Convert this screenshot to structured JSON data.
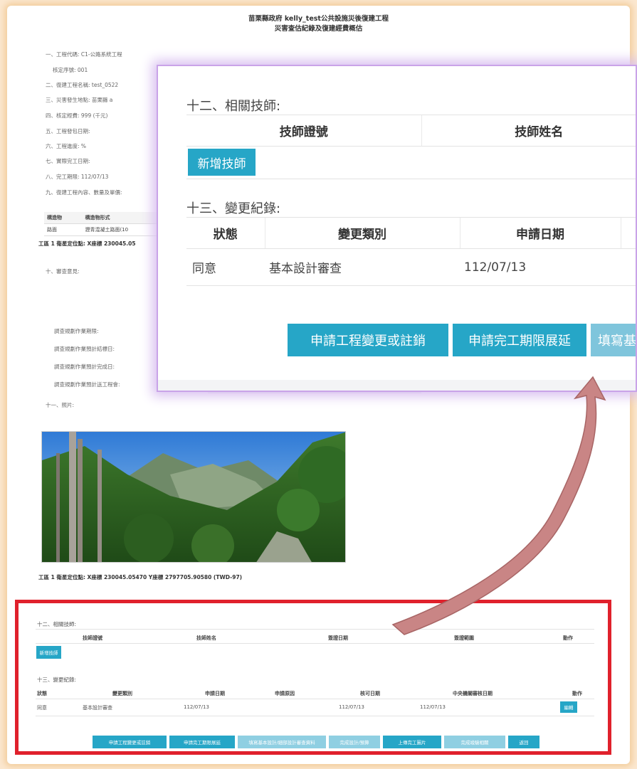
{
  "doc": {
    "title1": "苗栗縣政府 kelly_test公共設施災後復建工程",
    "title2": "災害查估紀錄及復建經費概估"
  },
  "items": [
    "一、工程代碼: C1-公路系統工程",
    "核定序號: 001",
    "二、復建工程名稱: test_0522",
    "三、災害發生地點: 苗栗縣 a",
    "四、核定經費: 999 (千元)",
    "五、工程發包日期:",
    "六、工程進度: %",
    "七、實際完工日期:",
    "八、完工期限: 112/07/13",
    "九、復建工程內容、數量及單價:"
  ],
  "mini_table": {
    "headers": [
      "構造物",
      "構造物形式"
    ],
    "row": [
      "路面",
      "瀝青混凝土路面(10"
    ]
  },
  "coord_partial": "工區 1 衛星定位點: X座標 230045.05",
  "review_label": "十、審查意見:",
  "schedule": [
    "調查規劃作業期限:",
    "調查規劃作業預計結標日:",
    "調查規劃作業預計完成日:",
    "調查規劃作業預計送工程會:"
  ],
  "photo_label": "十一、照片:",
  "photo_caption": "工區 1 衛星定位點: X座標 230045.05470  Y座標 2797705.90580 (TWD-97)",
  "zoom": {
    "sec12": "十二、相關技師:",
    "th_cert": "技師證號",
    "th_name": "技師姓名",
    "add_btn": "新增技師",
    "sec13": "十三、變更紀錄:",
    "th_status": "狀態",
    "th_type": "變更類別",
    "th_date": "申請日期",
    "row_status": "同意",
    "row_type": "基本設計審查",
    "row_date": "112/07/13",
    "btn1": "申請工程變更或註銷",
    "btn2": "申請完工期限展延",
    "btn3": "填寫基"
  },
  "bottom": {
    "sec12": "十二、相關技師:",
    "eng_headers": [
      "技師證號",
      "技師姓名",
      "簽證日期",
      "簽證範圍",
      "動作"
    ],
    "add_btn": "新增技師",
    "sec13": "十三、變更紀錄:",
    "chg_headers": [
      "狀態",
      "變更類別",
      "申請日期",
      "申請原因",
      "核可日期",
      "中央機關審核日期",
      "動作"
    ],
    "chg_row": [
      "同意",
      "基本設計審查",
      "112/07/13",
      "",
      "112/07/13",
      "112/07/13"
    ],
    "edit_btn": "編輯",
    "buttons": [
      "申請工程變更或註銷",
      "申請完工期限展延",
      "填寫基本設計/細部設計審查資料",
      "完成設計/預算",
      "上傳完工圖片",
      "完成竣驗相關",
      "返回"
    ]
  },
  "colors": {
    "button": "#26a6c7",
    "redbox": "#e0212c",
    "zoom_border": "#c9a3e8",
    "arrow": "#c98585"
  }
}
